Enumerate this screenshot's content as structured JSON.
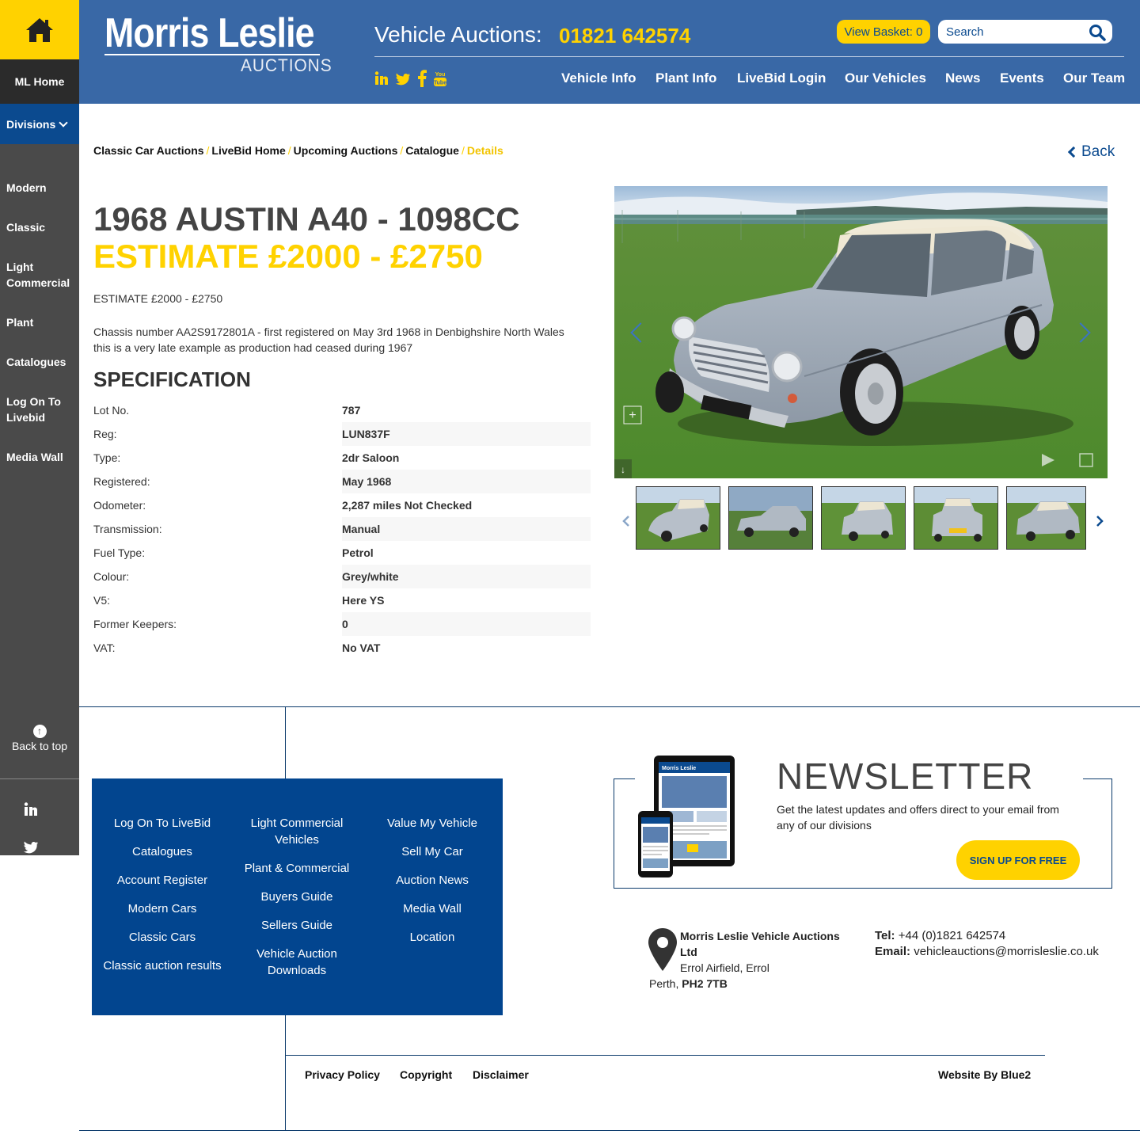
{
  "sidebar": {
    "ml_home": "ML Home",
    "divisions": "Divisions",
    "items": [
      {
        "label": "Modern"
      },
      {
        "label": "Classic"
      },
      {
        "label": "Light Commercial"
      },
      {
        "label": "Plant"
      },
      {
        "label": "Catalogues"
      },
      {
        "label": "Log On To Livebid"
      },
      {
        "label": "Media Wall"
      }
    ],
    "back_to_top": "Back to top"
  },
  "header": {
    "logo_main": "Morris Leslie",
    "logo_sub": "AUCTIONS",
    "vehicle_auctions_label": "Vehicle Auctions:",
    "phone": "01821 642574",
    "basket": "View Basket: 0",
    "search_placeholder": "Search",
    "nav": [
      "Vehicle Info",
      "Plant Info",
      "LiveBid Login",
      "Our Vehicles",
      "News",
      "Events",
      "Our Team"
    ]
  },
  "breadcrumb": {
    "items": [
      "Classic Car Auctions",
      "LiveBid Home",
      "Upcoming Auctions",
      "Catalogue"
    ],
    "current": "Details",
    "back": "Back"
  },
  "listing": {
    "title": "1968 AUSTIN A40 - 1098CC",
    "estimate_big": "ESTIMATE £2000 - £2750",
    "estimate_small": "ESTIMATE £2000 - £2750",
    "description": "Chassis number AA2S9172801A - first registered on May 3rd 1968 in Denbighshire North Wales this is a very late example as production had ceased during 1967",
    "spec_heading": "SPECIFICATION",
    "spec": [
      {
        "k": "Lot No.",
        "v": "787"
      },
      {
        "k": "Reg:",
        "v": "LUN837F"
      },
      {
        "k": "Type:",
        "v": "2dr Saloon"
      },
      {
        "k": "Registered:",
        "v": "May 1968"
      },
      {
        "k": "Odometer:",
        "v": "2,287 miles Not Checked"
      },
      {
        "k": "Transmission:",
        "v": "Manual"
      },
      {
        "k": "Fuel Type:",
        "v": "Petrol"
      },
      {
        "k": "Colour:",
        "v": "Grey/white"
      },
      {
        "k": "V5:",
        "v": "Here YS"
      },
      {
        "k": "Former Keepers:",
        "v": "0"
      },
      {
        "k": "VAT:",
        "v": "No VAT"
      }
    ]
  },
  "footer": {
    "col1": [
      "Log On To LiveBid",
      "Catalogues",
      "Account Register",
      "Modern Cars",
      "Classic Cars",
      "Classic auction results"
    ],
    "col2": [
      "Light Commercial Vehicles",
      "Plant & Commercial",
      "Buyers Guide",
      "Sellers Guide",
      "Vehicle Auction Downloads"
    ],
    "col3": [
      "Value My Vehicle",
      "Sell My Car",
      "Auction News",
      "Media Wall",
      "Location"
    ],
    "newsletter_title": "NEWSLETTER",
    "newsletter_text": "Get the latest updates and offers direct to your email from any of our divisions",
    "signup": "SIGN UP FOR FREE",
    "company": "Morris Leslie Vehicle Auctions Ltd",
    "address1": "Errol Airfield, Errol",
    "address2": "Perth,",
    "postcode": "PH2 7TB",
    "tel_label": "Tel:",
    "tel": "+44 (0)1821 642574",
    "email_label": "Email:",
    "email": "vehicleauctions@morrisleslie.co.uk",
    "privacy": "Privacy Policy",
    "copyright": "Copyright",
    "disclaimer": "Disclaimer",
    "credit": "Website By Blue2"
  },
  "colors": {
    "brand_blue": "#3968a6",
    "dark_blue": "#02458f",
    "yellow": "#ffd200",
    "sidebar": "#4a4a4a"
  }
}
